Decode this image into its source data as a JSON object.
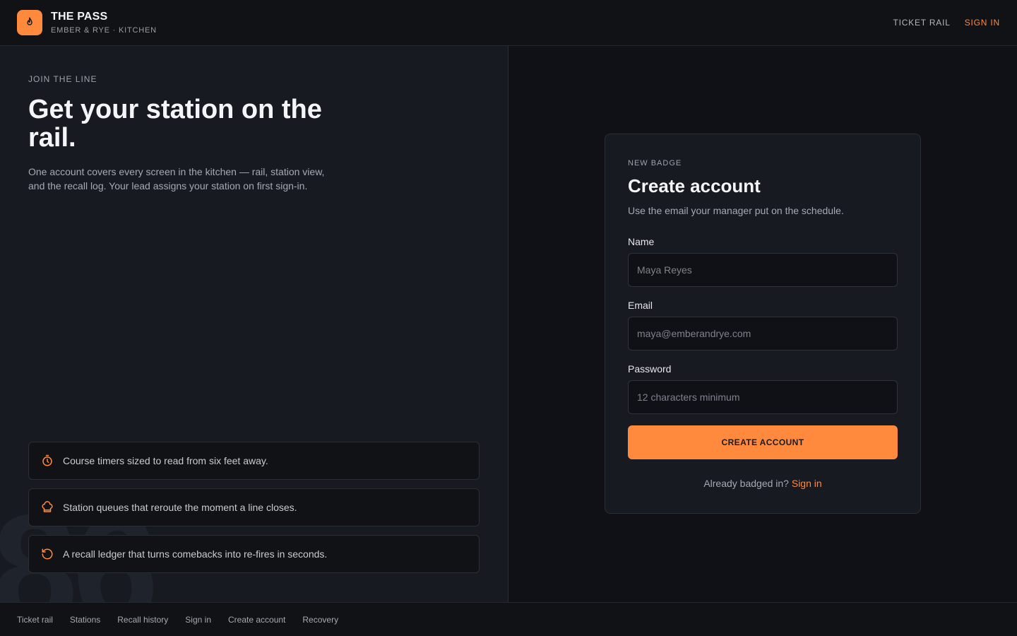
{
  "header": {
    "brand_title": "THE PASS",
    "brand_subtitle": "EMBER & RYE · KITCHEN",
    "logo_icon": "flame-icon",
    "nav": [
      {
        "label": "TICKET RAIL"
      },
      {
        "label": "SIGN IN",
        "accent": true
      }
    ]
  },
  "intro": {
    "eyebrow": "JOIN THE LINE",
    "headline": "Get your station on the rail.",
    "lede": "One account covers every screen in the kitchen — rail, station view, and the recall log. Your lead assigns your station on first sign-in.",
    "background_digits": "86"
  },
  "features": [
    {
      "icon": "stopwatch-icon",
      "text": "Course timers sized to read from six feet away."
    },
    {
      "icon": "chef-hat-icon",
      "text": "Station queues that reroute the moment a line closes."
    },
    {
      "icon": "rotate-ccw-icon",
      "text": "A recall ledger that turns comebacks into re-fires in seconds."
    }
  ],
  "form": {
    "eyebrow": "NEW BADGE",
    "title": "Create account",
    "subtitle": "Use the email your manager put on the schedule.",
    "name_label": "Name",
    "name_placeholder": "Maya Reyes",
    "email_label": "Email",
    "email_placeholder": "maya@emberandrye.com",
    "password_label": "Password",
    "password_placeholder": "12 characters minimum",
    "submit_label": "CREATE ACCOUNT",
    "already_text": "Already badged in?",
    "signin_link": "Sign in"
  },
  "footer": {
    "links": [
      "Ticket rail",
      "Stations",
      "Recall history",
      "Sign in",
      "Create account",
      "Recovery"
    ]
  },
  "colors": {
    "accent": "#ff8a3d",
    "background": "#101116",
    "panel": "#171a21"
  }
}
